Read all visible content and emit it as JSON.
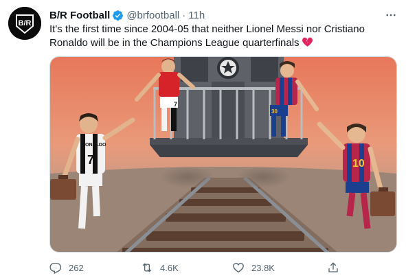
{
  "tweet": {
    "display_name": "B/R Football",
    "handle": "@brfootball",
    "separator": "·",
    "time": "11h",
    "text": "It's the first time since 2004-05 that neither Lionel Messi nor Cristiano Ronaldo will be in the Champions League quarterfinals",
    "avatar_logo": "B/R",
    "verified_icon": "verified-badge-icon",
    "emoji_icon": "broken-heart-icon",
    "more_icon": "more-icon"
  },
  "media": {
    "jersey_numbers": {
      "ronaldo_left": "7",
      "ronaldo_name": "RONALDO",
      "ronaldo_train": "7",
      "messi_train": "30",
      "messi_right": "10"
    }
  },
  "actions": {
    "reply_count": "262",
    "retweet_count": "4.6K",
    "like_count": "23.8K",
    "reply_icon": "reply-icon",
    "retweet_icon": "retweet-icon",
    "like_icon": "heart-icon",
    "share_icon": "share-icon"
  },
  "colors": {
    "text": "#0f1419",
    "secondary": "#536471",
    "verified": "#1d9bf0",
    "broken_heart": "#e0245e"
  }
}
